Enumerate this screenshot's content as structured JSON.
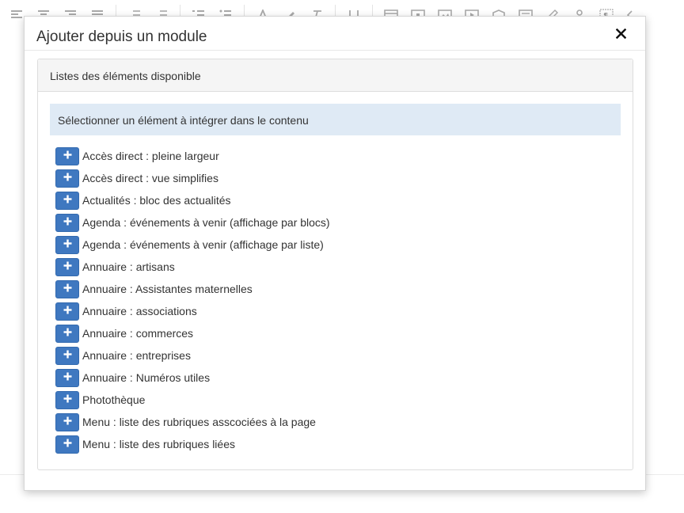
{
  "modal": {
    "title": "Ajouter depuis un module",
    "close_icon": "close-icon"
  },
  "panel": {
    "heading": "Listes des éléments disponible",
    "info": "Sélectionner un élément à intégrer dans le contenu"
  },
  "items": [
    {
      "label": "Accès direct : pleine largeur"
    },
    {
      "label": "Accès direct : vue simplifies"
    },
    {
      "label": "Actualités : bloc des actualités"
    },
    {
      "label": "Agenda : événements à venir (affichage par blocs)"
    },
    {
      "label": "Agenda : événements à venir (affichage par liste)"
    },
    {
      "label": "Annuaire : artisans"
    },
    {
      "label": "Annuaire : Assistantes maternelles"
    },
    {
      "label": "Annuaire : associations"
    },
    {
      "label": "Annuaire : commerces"
    },
    {
      "label": "Annuaire : entreprises"
    },
    {
      "label": "Annuaire : Numéros utiles"
    },
    {
      "label": "Photothèque"
    },
    {
      "label": "Menu : liste des rubriques asscociées à la page"
    },
    {
      "label": "Menu : liste des rubriques liées"
    }
  ],
  "colors": {
    "add_button": "#3f78c0",
    "info_bar": "#dfeaf5",
    "panel_heading": "#f5f5f5"
  },
  "toolbar_icons": [
    "align-left-icon",
    "align-center-icon",
    "align-right-icon",
    "align-justify-icon",
    "outdent-icon",
    "indent-icon",
    "ordered-list-icon",
    "unordered-list-icon",
    "text-color-icon",
    "highlight-icon",
    "clear-format-icon",
    "heading-icon",
    "table-icon",
    "image-icon",
    "gallery-icon",
    "video-icon",
    "module-icon",
    "template-icon",
    "edit-icon",
    "user-icon",
    "show-blocks-icon",
    "code-icon"
  ]
}
